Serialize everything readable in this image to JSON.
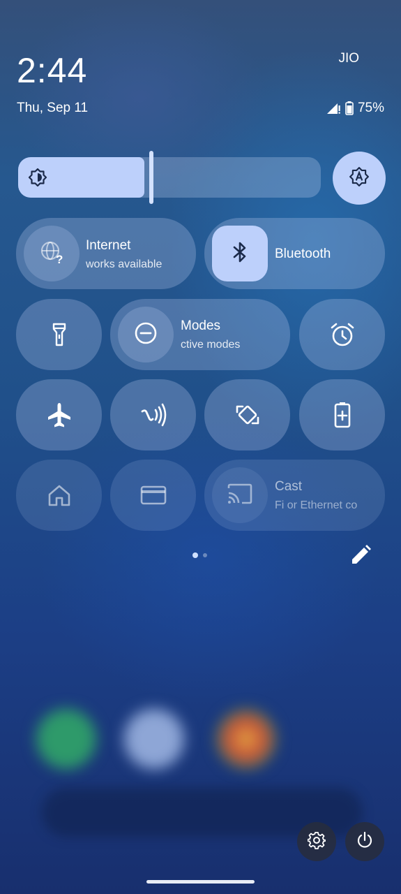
{
  "header": {
    "time": "2:44",
    "date": "Thu, Sep 11",
    "carrier": "JIO",
    "battery_percent": "75%",
    "battery_level": 0.75
  },
  "brightness": {
    "level": 0.42,
    "icon": "brightness-icon",
    "auto_icon": "auto-brightness-icon"
  },
  "tiles": {
    "internet": {
      "title": "Internet",
      "subtitle": "works available",
      "icon": "globe-question-icon"
    },
    "bluetooth": {
      "title": "Bluetooth",
      "icon": "bluetooth-icon"
    },
    "flashlight": {
      "icon": "flashlight-icon"
    },
    "modes": {
      "title": "Modes",
      "subtitle": "ctive modes",
      "icon": "do-not-disturb-icon"
    },
    "alarm": {
      "icon": "alarm-icon"
    },
    "airplane": {
      "icon": "airplane-icon"
    },
    "nfc": {
      "icon": "nfc-icon"
    },
    "rotate": {
      "icon": "auto-rotate-icon"
    },
    "battery_saver": {
      "icon": "battery-saver-icon"
    },
    "home": {
      "icon": "home-icon"
    },
    "wallet": {
      "icon": "wallet-card-icon"
    },
    "cast": {
      "title": "Cast",
      "subtitle": "Fi or Ethernet co",
      "icon": "cast-icon"
    }
  },
  "footer": {
    "edit_icon": "pencil-icon",
    "settings_icon": "gear-icon",
    "power_icon": "power-icon"
  },
  "colors": {
    "accent": "#bdd0fb",
    "tile_bg": "rgba(190,205,240,0.28)"
  }
}
